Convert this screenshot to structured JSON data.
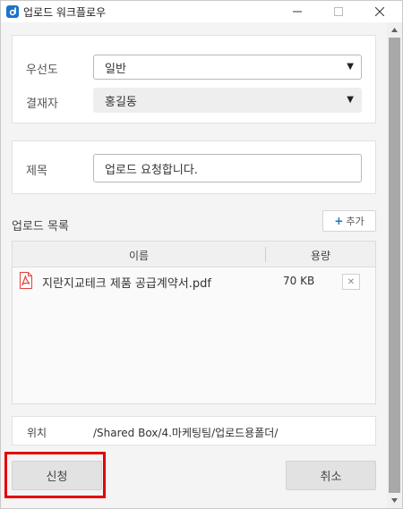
{
  "window": {
    "title": "업로드 워크플로우",
    "minimize_glyph": "—",
    "maximize_glyph": "☐",
    "close_glyph": "✕"
  },
  "form": {
    "priority_label": "우선도",
    "priority_value": "일반",
    "approver_label": "결재자",
    "approver_value": "홍길동",
    "subject_label": "제목",
    "subject_value": "업로드 요청합니다."
  },
  "upload_list": {
    "title": "업로드 목록",
    "add_label": "추가",
    "columns": {
      "name": "이름",
      "size": "용량"
    },
    "files": [
      {
        "name": "지란지교테크 제품 공급계약서.pdf",
        "size": "70 KB",
        "icon": "pdf-icon"
      }
    ],
    "remove_glyph": "✕"
  },
  "location": {
    "label": "위치",
    "path": "/Shared Box/4.마케팅팀/업로드용폴더/"
  },
  "buttons": {
    "submit_label": "신청",
    "cancel_label": "취소"
  },
  "colors": {
    "accent": "#1a73c8",
    "highlight": "#e40000",
    "pdf": "#e0443a"
  }
}
